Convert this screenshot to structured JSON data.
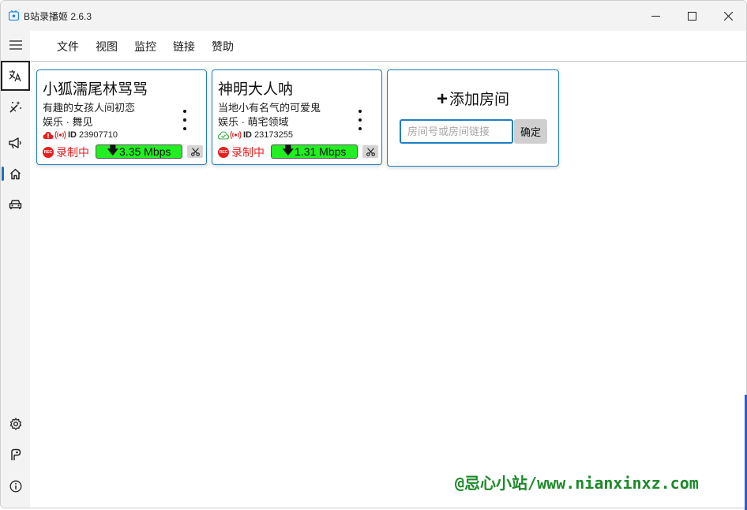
{
  "window": {
    "title": "B站录播姬 2.6.3"
  },
  "menu": [
    "文件",
    "视图",
    "监控",
    "链接",
    "赞助"
  ],
  "sidebar": {
    "items": [
      "language-icon",
      "magic-icon",
      "announcement-icon",
      "home-icon",
      "car-icon",
      "settings-icon",
      "toolbox-icon",
      "info-icon"
    ]
  },
  "rooms": [
    {
      "name": "小狐濡尾林骂骂",
      "description": "有趣的女孩人间初恋",
      "area": "娱乐 · 舞见",
      "id_label": "ID",
      "room_id": "23907710",
      "status_text": "录制中",
      "speed": "3.35 Mbps",
      "status_icon_color": "#e02020"
    },
    {
      "name": "神明大人呐",
      "description": "当地小有名气的可爱鬼",
      "area": "娱乐 · 萌宅领域",
      "id_label": "ID",
      "room_id": "23173255",
      "status_text": "录制中",
      "speed": "1.31 Mbps",
      "status_icon_color": "#3aa845"
    }
  ],
  "add_room": {
    "title": "添加房间",
    "placeholder": "房间号或房间链接",
    "confirm_label": "确定"
  },
  "watermark": "@忌心小站/www.nianxinxz.com",
  "colors": {
    "accent": "#1f7fc4",
    "recording": "#e62020",
    "speed_bg": "#22ee22",
    "watermark": "#1c8a2a"
  }
}
